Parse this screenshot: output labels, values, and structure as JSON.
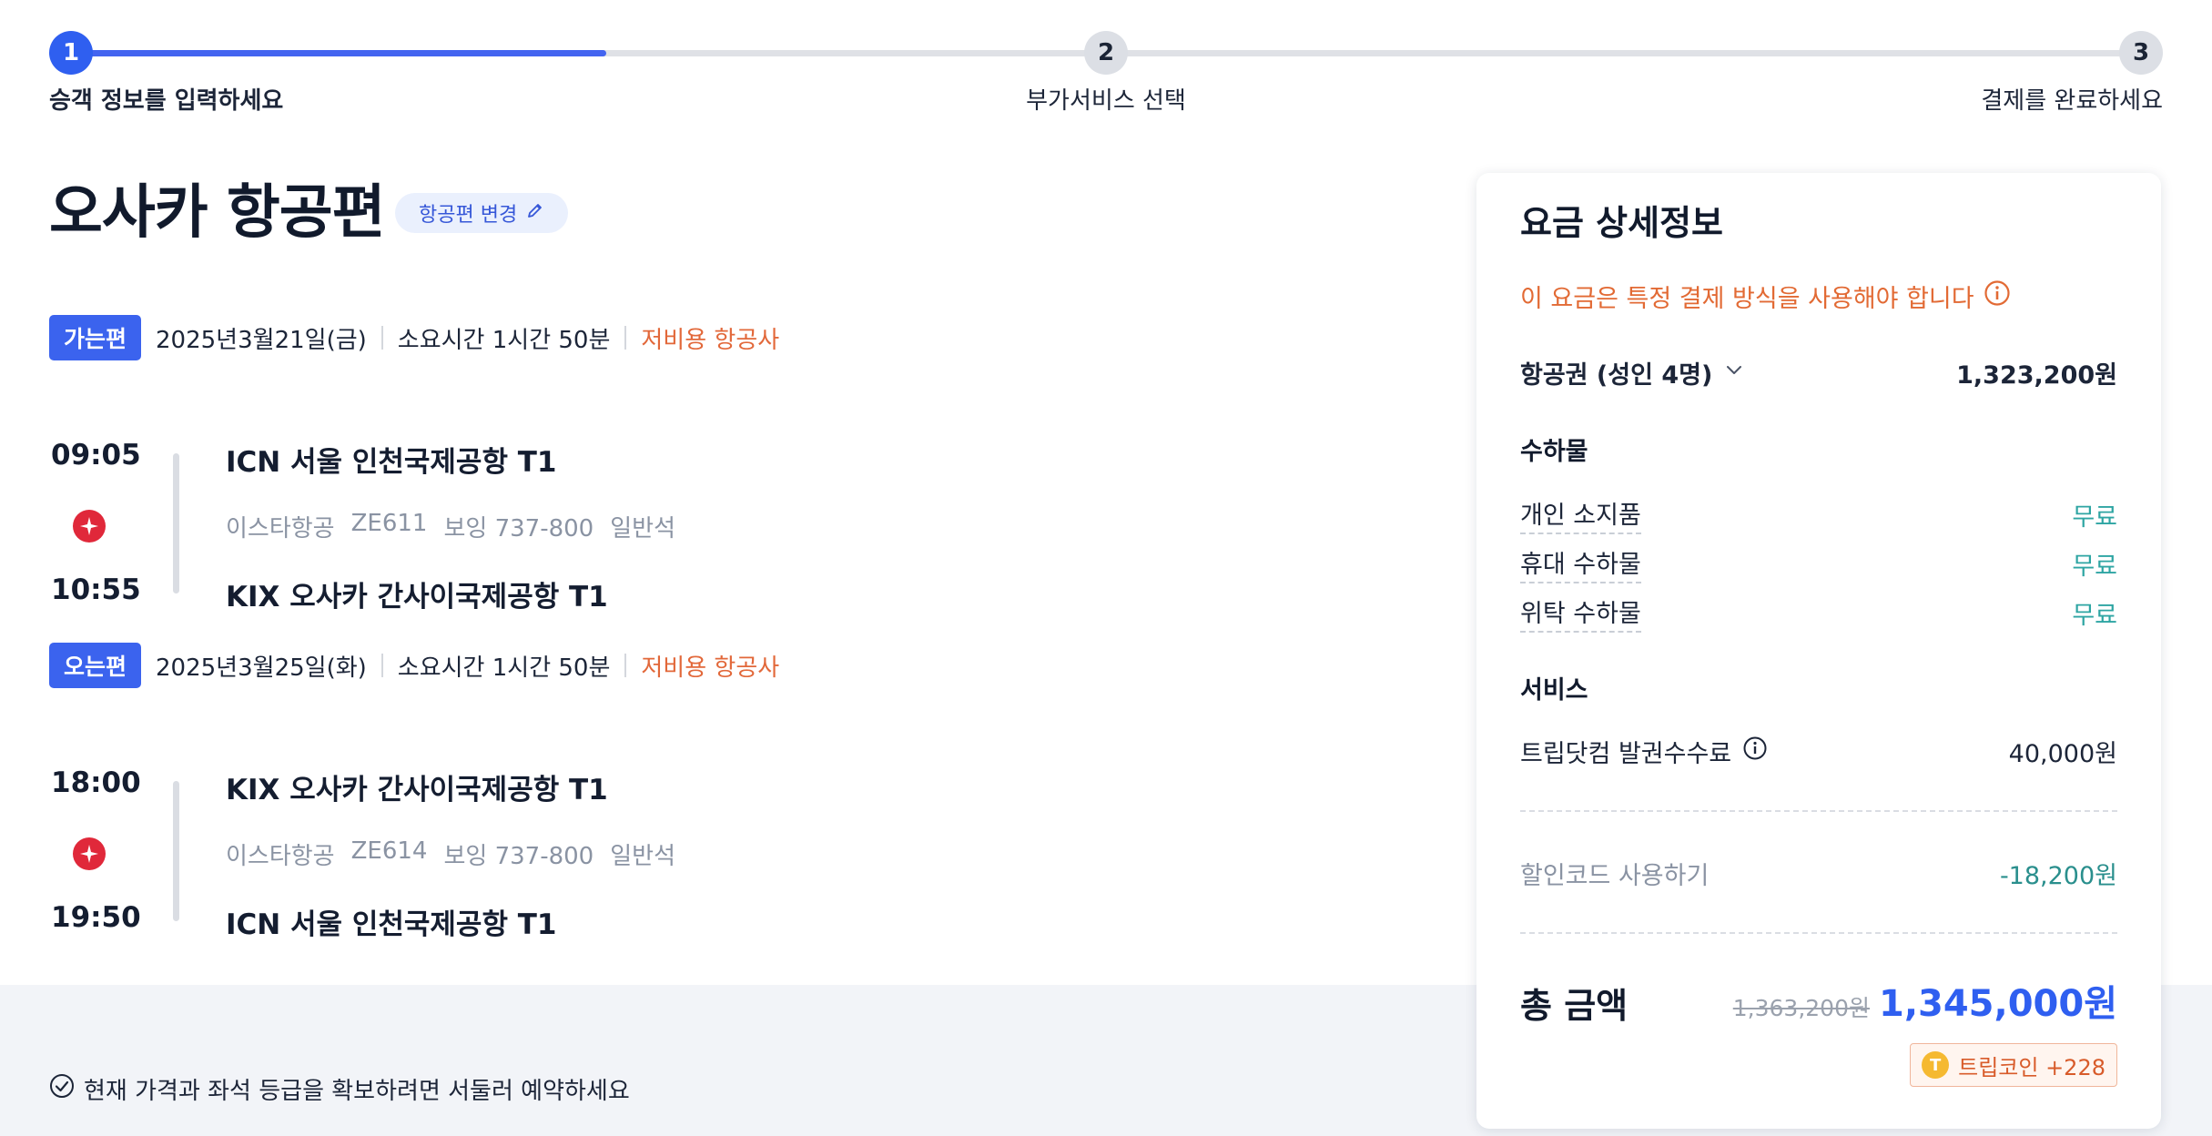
{
  "stepper": {
    "steps": [
      {
        "number": "1",
        "label": "승객 정보를 입력하세요"
      },
      {
        "number": "2",
        "label": "부가서비스 선택"
      },
      {
        "number": "3",
        "label": "결제를 완료하세요"
      }
    ],
    "current_step": 1
  },
  "page_title": "오사카 항공편",
  "change_flight_label": "항공편 변경",
  "outbound": {
    "badge": "가는편",
    "date": "2025년3월21일(금)",
    "duration": "소요시간 1시간 50분",
    "carrier_type": "저비용 항공사",
    "depart_time": "09:05",
    "depart_airport": "ICN 서울 인천국제공항 T1",
    "airline": "이스타항공",
    "flight_no": "ZE611",
    "aircraft": "보잉 737-800",
    "cabin": "일반석",
    "arrive_time": "10:55",
    "arrive_airport": "KIX 오사카 간사이국제공항 T1"
  },
  "inbound": {
    "badge": "오는편",
    "date": "2025년3월25일(화)",
    "duration": "소요시간 1시간 50분",
    "carrier_type": "저비용 항공사",
    "depart_time": "18:00",
    "depart_airport": "KIX 오사카 간사이국제공항 T1",
    "airline": "이스타항공",
    "flight_no": "ZE614",
    "aircraft": "보잉 737-800",
    "cabin": "일반석",
    "arrive_time": "19:50",
    "arrive_airport": "ICN 서울 인천국제공항 T1"
  },
  "notice": "현재 가격과 좌석 등급을 확보하려면 서둘러 예약하세요",
  "fare": {
    "title": "요금 상세정보",
    "warning": "이 요금은 특정 결제 방식을 사용해야 합니다",
    "ticket_label": "항공권 (성인 4명)",
    "ticket_price": "1,323,200원",
    "baggage_title": "수하물",
    "baggage": [
      {
        "label": "개인 소지품",
        "value": "무료"
      },
      {
        "label": "휴대 수하물",
        "value": "무료"
      },
      {
        "label": "위탁 수하물",
        "value": "무료"
      }
    ],
    "service_title": "서비스",
    "service_label": "트립닷컴 발권수수료",
    "service_price": "40,000원",
    "discount_label": "할인코드 사용하기",
    "discount_value": "-18,200원",
    "total_label": "총 금액",
    "original_total": "1,363,200원",
    "total": "1,345,000원",
    "coin_label": "트립코인 +228",
    "coin_icon_letter": "T"
  },
  "colors": {
    "accent": "#2f5ff0",
    "warning": "#e26a34",
    "free": "#2ea5a3",
    "airline_logo": "#e0283a"
  }
}
